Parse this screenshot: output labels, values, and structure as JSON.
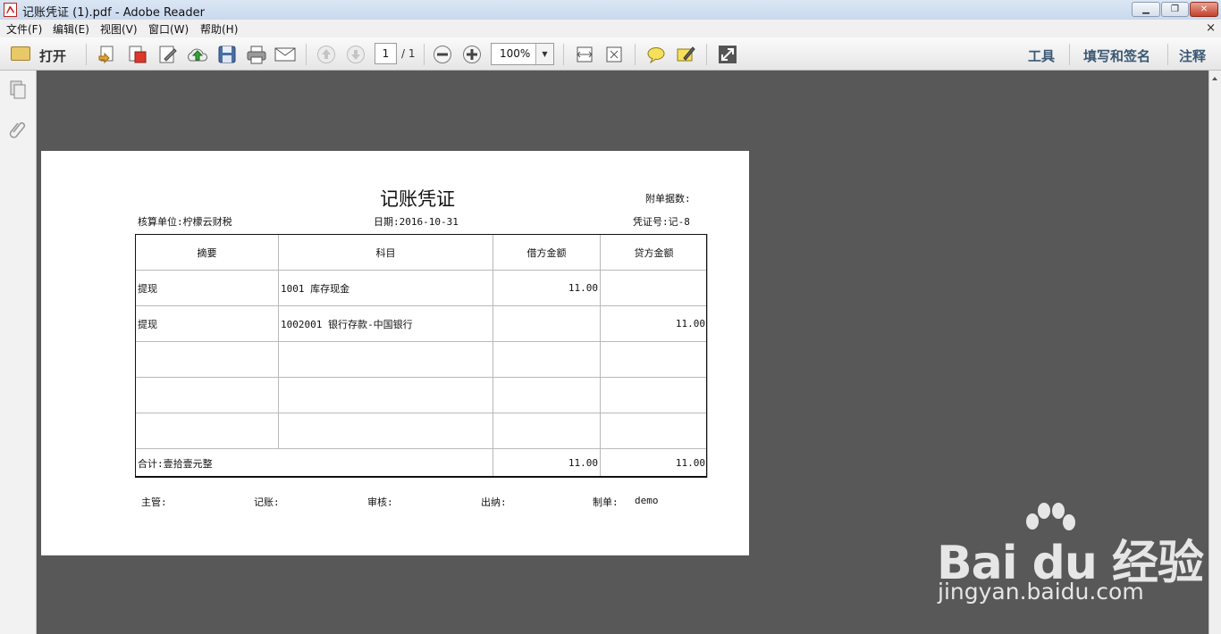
{
  "window": {
    "title": "记账凭证 (1).pdf - Adobe Reader",
    "minimize": "▁",
    "maximize": "❐",
    "close": "✕"
  },
  "menu": {
    "items": [
      "文件(F)",
      "编辑(E)",
      "视图(V)",
      "窗口(W)",
      "帮助(H)"
    ],
    "close_x": "×"
  },
  "toolbar": {
    "open_label": "打开",
    "page_current": "1",
    "page_total": "/ 1",
    "zoom": "100%",
    "zoom_arrow": "▼",
    "minus": "−",
    "plus": "+",
    "tools": "工具",
    "fill_sign": "填写和签名",
    "comment": "注释"
  },
  "voucher": {
    "title": "记账凭证",
    "attachments": "附单据数:",
    "unit": "核算单位:柠檬云财税",
    "date": "日期:2016-10-31",
    "number": "凭证号:记-8",
    "headers": [
      "摘要",
      "科目",
      "借方金额",
      "贷方金额"
    ],
    "rows": [
      {
        "summary": "提现",
        "account": "1001 库存现金",
        "debit": "11.00",
        "credit": ""
      },
      {
        "summary": "提现",
        "account": "1002001 银行存款-中国银行",
        "debit": "",
        "credit": "11.00"
      },
      {
        "summary": "",
        "account": "",
        "debit": "",
        "credit": ""
      },
      {
        "summary": "",
        "account": "",
        "debit": "",
        "credit": ""
      },
      {
        "summary": "",
        "account": "",
        "debit": "",
        "credit": ""
      }
    ],
    "total_label": "合计:壹拾壹元整",
    "total_debit": "11.00",
    "total_credit": "11.00",
    "footer": {
      "supervisor": "主管:",
      "bookkeeper": "记账:",
      "reviewer": "审核:",
      "cashier": "出纳:",
      "preparer_label": "制单:",
      "preparer": "demo"
    }
  },
  "watermark": {
    "brand": "Bai du 经验",
    "url": "jingyan.baidu.com"
  }
}
